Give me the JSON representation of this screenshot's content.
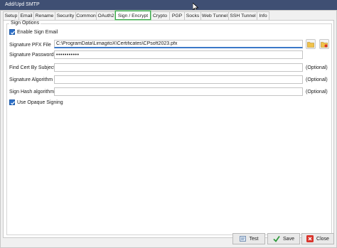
{
  "window": {
    "title": "Add/Upd SMTP"
  },
  "tabs": [
    {
      "label": "Setup"
    },
    {
      "label": "Email"
    },
    {
      "label": "Rename"
    },
    {
      "label": "Security"
    },
    {
      "label": "Common"
    },
    {
      "label": "OAuth2"
    },
    {
      "label": "Sign / Encrypt",
      "active": true
    },
    {
      "label": "Crypto"
    },
    {
      "label": "PGP"
    },
    {
      "label": "Socks"
    },
    {
      "label": "Web Tunnel"
    },
    {
      "label": "SSH Tunnel"
    },
    {
      "label": "Info"
    }
  ],
  "sign_options": {
    "group_title": "Sign Options",
    "enable_sign_email": {
      "label": "Enable Sign Email",
      "checked": true
    },
    "pfx_file": {
      "label": "Signature PFX File",
      "value": "C:\\ProgramData\\LimagitoX\\Certificates\\CPsoft2023.pfx"
    },
    "password": {
      "label": "Signature Password",
      "value": "•••••••••••"
    },
    "cert_by_subject": {
      "label": "Find Cert By Subject",
      "value": "",
      "note": "(Optional)"
    },
    "sig_algorithm": {
      "label": "Signature Algorithm",
      "value": "",
      "note": "(Optional)"
    },
    "hash_algorithm": {
      "label": "Sign Hash algorithm",
      "value": "",
      "note": "(Optional)"
    },
    "opaque_signing": {
      "label": "Use Opaque Signing",
      "checked": true
    }
  },
  "buttons": {
    "test": "Test",
    "save": "Save",
    "close": "Close"
  },
  "colors": {
    "titlebar": "#3f4f73",
    "active_tab_border": "#3aa64a",
    "checkbox": "#2c6fc8"
  },
  "icons": {
    "browse": "folder-icon",
    "clear": "folder-clear-icon",
    "test": "test-icon",
    "save": "checkmark-icon",
    "close": "close-icon"
  }
}
